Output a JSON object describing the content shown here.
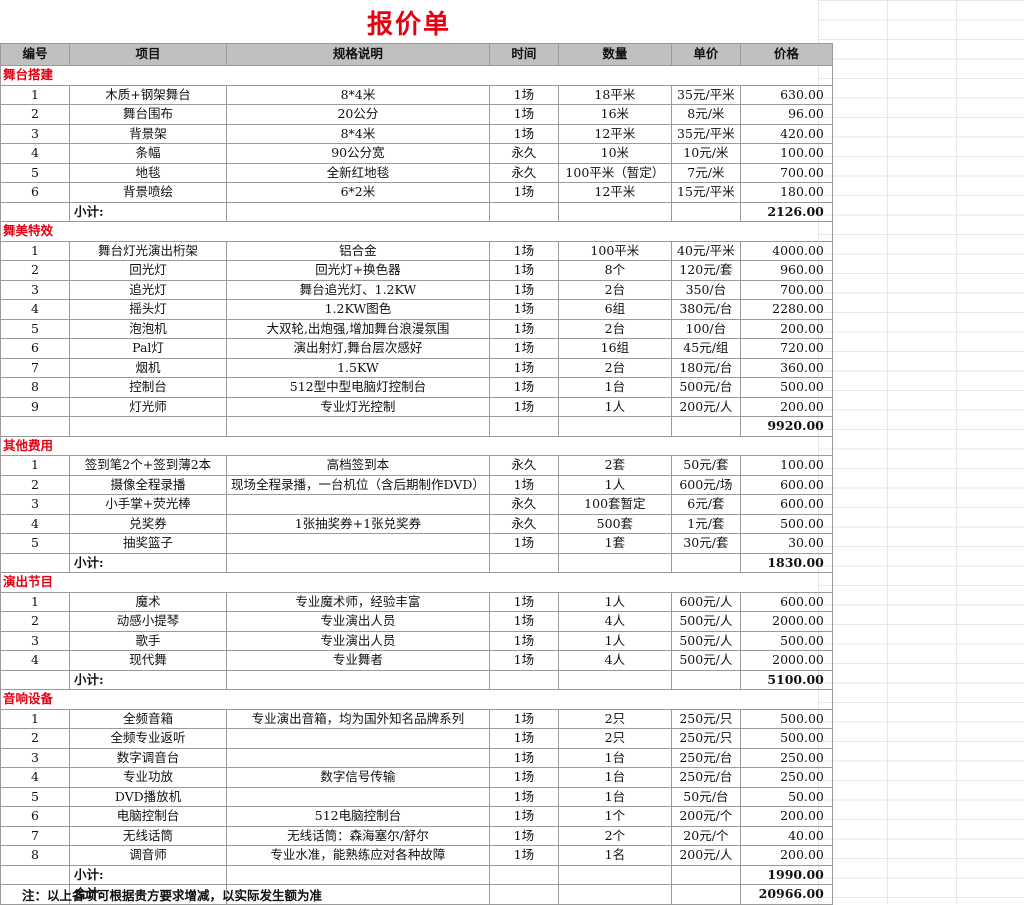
{
  "title": "报价单",
  "headers": [
    "编号",
    "项目",
    "规格说明",
    "时间",
    "数量",
    "单价",
    "价格"
  ],
  "sections": [
    {
      "name": "舞台搭建",
      "rows": [
        [
          "1",
          "木质+钢架舞台",
          "8*4米",
          "1场",
          "18平米",
          "35元/平米",
          "630.00"
        ],
        [
          "2",
          "舞台围布",
          "20公分",
          "1场",
          "16米",
          "8元/米",
          "96.00"
        ],
        [
          "3",
          "背景架",
          "8*4米",
          "1场",
          "12平米",
          "35元/平米",
          "420.00"
        ],
        [
          "4",
          "条幅",
          "90公分宽",
          "永久",
          "10米",
          "10元/米",
          "100.00"
        ],
        [
          "5",
          "地毯",
          "全新红地毯",
          "永久",
          "100平米（暂定）",
          "7元/米",
          "700.00"
        ],
        [
          "6",
          "背景喷绘",
          "6*2米",
          "1场",
          "12平米",
          "15元/平米",
          "180.00"
        ]
      ],
      "subtotal_label": "小计:",
      "subtotal": "2126.00"
    },
    {
      "name": "舞美特效",
      "rows": [
        [
          "1",
          "舞台灯光演出桁架",
          "铝合金",
          "1场",
          "100平米",
          "40元/平米",
          "4000.00"
        ],
        [
          "2",
          "回光灯",
          "回光灯+换色器",
          "1场",
          "8个",
          "120元/套",
          "960.00"
        ],
        [
          "3",
          "追光灯",
          "舞台追光灯、1.2KW",
          "1场",
          "2台",
          "350/台",
          "700.00"
        ],
        [
          "4",
          "摇头灯",
          "1.2KW图色",
          "1场",
          "6组",
          "380元/台",
          "2280.00"
        ],
        [
          "5",
          "泡泡机",
          "大双轮,出炮强,增加舞台浪漫氛围",
          "1场",
          "2台",
          "100/台",
          "200.00"
        ],
        [
          "6",
          "Pal灯",
          "演出射灯,舞台层次感好",
          "1场",
          "16组",
          "45元/组",
          "720.00"
        ],
        [
          "7",
          "烟机",
          "1.5KW",
          "1场",
          "2台",
          "180元/台",
          "360.00"
        ],
        [
          "8",
          "控制台",
          "512型中型电脑灯控制台",
          "1场",
          "1台",
          "500元/台",
          "500.00"
        ],
        [
          "9",
          "灯光师",
          "专业灯光控制",
          "1场",
          "1人",
          "200元/人",
          "200.00"
        ]
      ],
      "subtotal_label": "",
      "subtotal": "9920.00"
    },
    {
      "name": "其他费用",
      "rows": [
        [
          "1",
          "签到笔2个+签到薄2本",
          "高档签到本",
          "永久",
          "2套",
          "50元/套",
          "100.00"
        ],
        [
          "2",
          "摄像全程录播",
          "现场全程录播，一台机位（含后期制作DVD）",
          "1场",
          "1人",
          "600元/场",
          "600.00"
        ],
        [
          "3",
          "小手掌+荧光棒",
          "",
          "永久",
          "100套暂定",
          "6元/套",
          "600.00"
        ],
        [
          "4",
          "兑奖券",
          "1张抽奖券+1张兑奖券",
          "永久",
          "500套",
          "1元/套",
          "500.00"
        ],
        [
          "5",
          "抽奖篮子",
          "",
          "1场",
          "1套",
          "30元/套",
          "30.00"
        ]
      ],
      "subtotal_label": "小计:",
      "subtotal": "1830.00"
    },
    {
      "name": "演出节目",
      "rows": [
        [
          "1",
          "魔术",
          "专业魔术师，经验丰富",
          "1场",
          "1人",
          "600元/人",
          "600.00"
        ],
        [
          "2",
          "动感小提琴",
          "专业演出人员",
          "1场",
          "4人",
          "500元/人",
          "2000.00"
        ],
        [
          "3",
          "歌手",
          "专业演出人员",
          "1场",
          "1人",
          "500元/人",
          "500.00"
        ],
        [
          "4",
          "现代舞",
          "专业舞者",
          "1场",
          "4人",
          "500元/人",
          "2000.00"
        ]
      ],
      "subtotal_label": "小计:",
      "subtotal": "5100.00"
    },
    {
      "name": "音响设备",
      "rows": [
        [
          "1",
          "全频音箱",
          "专业演出音箱，均为国外知名品牌系列",
          "1场",
          "2只",
          "250元/只",
          "500.00"
        ],
        [
          "2",
          "全频专业返听",
          "",
          "1场",
          "2只",
          "250元/只",
          "500.00"
        ],
        [
          "3",
          "数字调音台",
          "",
          "1场",
          "1台",
          "250元/台",
          "250.00"
        ],
        [
          "4",
          "专业功放",
          "数字信号传输",
          "1场",
          "1台",
          "250元/台",
          "250.00"
        ],
        [
          "5",
          "DVD播放机",
          "",
          "1场",
          "1台",
          "50元/台",
          "50.00"
        ],
        [
          "6",
          "电脑控制台",
          "512电脑控制台",
          "1场",
          "1个",
          "200元/个",
          "200.00"
        ],
        [
          "7",
          "无线话筒",
          "无线话筒：森海塞尔/舒尔",
          "1场",
          "2个",
          "20元/个",
          "40.00"
        ],
        [
          "8",
          "调音师",
          "专业水准，能熟练应对各种故障",
          "1场",
          "1名",
          "200元/人",
          "200.00"
        ]
      ],
      "subtotal_label": "小计:",
      "subtotal": "1990.00"
    }
  ],
  "total_label": "合计:",
  "total": "20966.00",
  "note": "注：以上各项可根据贵方要求增减，以实际发生额为准"
}
